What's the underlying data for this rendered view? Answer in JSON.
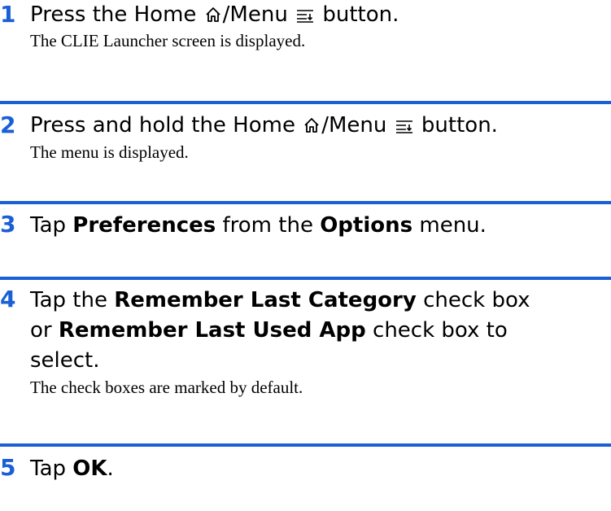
{
  "steps": [
    {
      "number": "1",
      "parts": [
        "Press the Home ",
        "/Menu ",
        " button."
      ],
      "description": "The CLIE Launcher screen is displayed."
    },
    {
      "number": "2",
      "parts": [
        "Press and hold the Home ",
        "/Menu ",
        " button."
      ],
      "description": "The menu is displayed."
    },
    {
      "number": "3",
      "parts": [
        "Tap ",
        "Preferences",
        " from the ",
        "Options",
        " menu."
      ]
    },
    {
      "number": "4",
      "parts": [
        "Tap the ",
        "Remember Last Category",
        " check box",
        "or ",
        "Remember Last Used App",
        " check box to",
        "select."
      ],
      "description": "The check boxes are marked by default."
    },
    {
      "number": "5",
      "parts": [
        "Tap ",
        "OK",
        "."
      ]
    }
  ],
  "icons": {
    "home": "home-icon",
    "menu": "menu-icon"
  },
  "colors": {
    "accent": "#1a5fd6",
    "text": "#000000"
  }
}
